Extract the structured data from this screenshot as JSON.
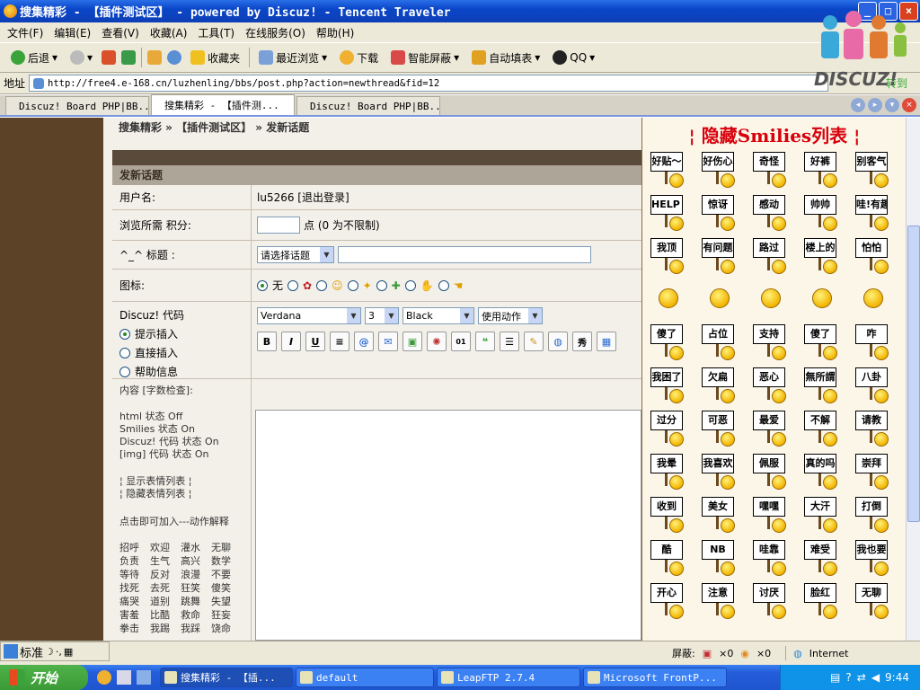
{
  "window": {
    "title": "搜集精彩 - 【插件测试区】 - powered by Discuz! - Tencent Traveler"
  },
  "menu": [
    "文件(F)",
    "编辑(E)",
    "查看(V)",
    "收藏(A)",
    "工具(T)",
    "在线服务(O)",
    "帮助(H)"
  ],
  "toolbar": {
    "back": "后退",
    "favorites": "收藏夹",
    "recent": "最近浏览",
    "download": "下载",
    "smart_block": "智能屏蔽",
    "autofill": "自动填表",
    "qq": "QQ"
  },
  "address": {
    "label": "地址",
    "url": "http://free4.e-168.cn/luzhenling/bbs/post.php?action=newthread&fid=12",
    "go": "转到"
  },
  "tabs": [
    "Discuz! Board PHP|BB...",
    "搜集精彩 - 【插件测...",
    "Discuz! Board PHP|BB..."
  ],
  "breadcrumb": "搜集精彩 » 【插件测试区】 » 发新话题",
  "form": {
    "header": "发新话题",
    "username_label": "用户名:",
    "username_value": "lu5266 [退出登录]",
    "credits_label": "浏览所需 积分:",
    "credits_hint": "点 (0 为不限制)",
    "subject_label": "^_^ 标题 :",
    "subject_select": "请选择话题",
    "icon_label": "图标:",
    "icon_none": "无",
    "discuz_label": "Discuz! 代码",
    "mode_options": [
      "提示插入",
      "直接插入",
      "帮助信息"
    ],
    "font": "Verdana",
    "size": "3",
    "color": "Black",
    "action": "使用动作",
    "content_label": "内容 [字数检查]:",
    "status_lines": [
      "html 状态 Off",
      "Smilies 状态 On",
      "Discuz! 代码 状态 On",
      "[img] 代码 状态 On"
    ],
    "smilies_links": [
      "显示表情列表",
      "隐藏表情列表"
    ],
    "actions_hint": "点击即可加入---动作解释",
    "actions": [
      [
        "招呼",
        "欢迎",
        "灌水",
        "无聊"
      ],
      [
        "负责",
        "生气",
        "高兴",
        "数学"
      ],
      [
        "等待",
        "反对",
        "浪漫",
        "不要"
      ],
      [
        "找死",
        "去死",
        "狂笑",
        "傻笑"
      ],
      [
        "痛哭",
        "道别",
        "跳舞",
        "失望"
      ],
      [
        "害羞",
        "比酷",
        "救命",
        "狂妄"
      ],
      [
        "拳击",
        "我踢",
        "我踩",
        "饶命"
      ]
    ]
  },
  "smilies": {
    "title": "隐藏Smilies列表",
    "items": [
      "好贴～",
      "好伤心",
      "奇怪",
      "好裤",
      "别客气",
      "HELP ME",
      "惊讶",
      "感动",
      "帅帅",
      "哇!有趣",
      "我顶",
      "有问题",
      "路过",
      "楼上的",
      "怕怕",
      "",
      "",
      "",
      "",
      "",
      "傻了",
      "占位",
      "支持",
      "傻了",
      "咋",
      "我困了",
      "欠扁",
      "恶心",
      "無所謂",
      "八卦",
      "过分",
      "可恶",
      "最爱",
      "不解",
      "请教",
      "我晕",
      "我喜欢",
      "佩服",
      "真的吗",
      "崇拜",
      "收到",
      "美女",
      "嘿嘿",
      "大汗",
      "打倒",
      "酷",
      "NB",
      "哇靠",
      "难受",
      "我也要",
      "开心",
      "注意",
      "讨厌",
      "脸红",
      "无聊"
    ]
  },
  "logo": {
    "text": "DISCUZ!"
  },
  "status": {
    "block": "屏蔽:",
    "count1": "×0",
    "count2": "×0",
    "zone": "Internet"
  },
  "ime": {
    "label": "标准"
  },
  "taskbar": {
    "start": "开始",
    "items": [
      "搜集精彩 - 【插...",
      "default",
      "LeapFTP 2.7.4",
      "Microsoft FrontP..."
    ],
    "time": "9:44"
  }
}
